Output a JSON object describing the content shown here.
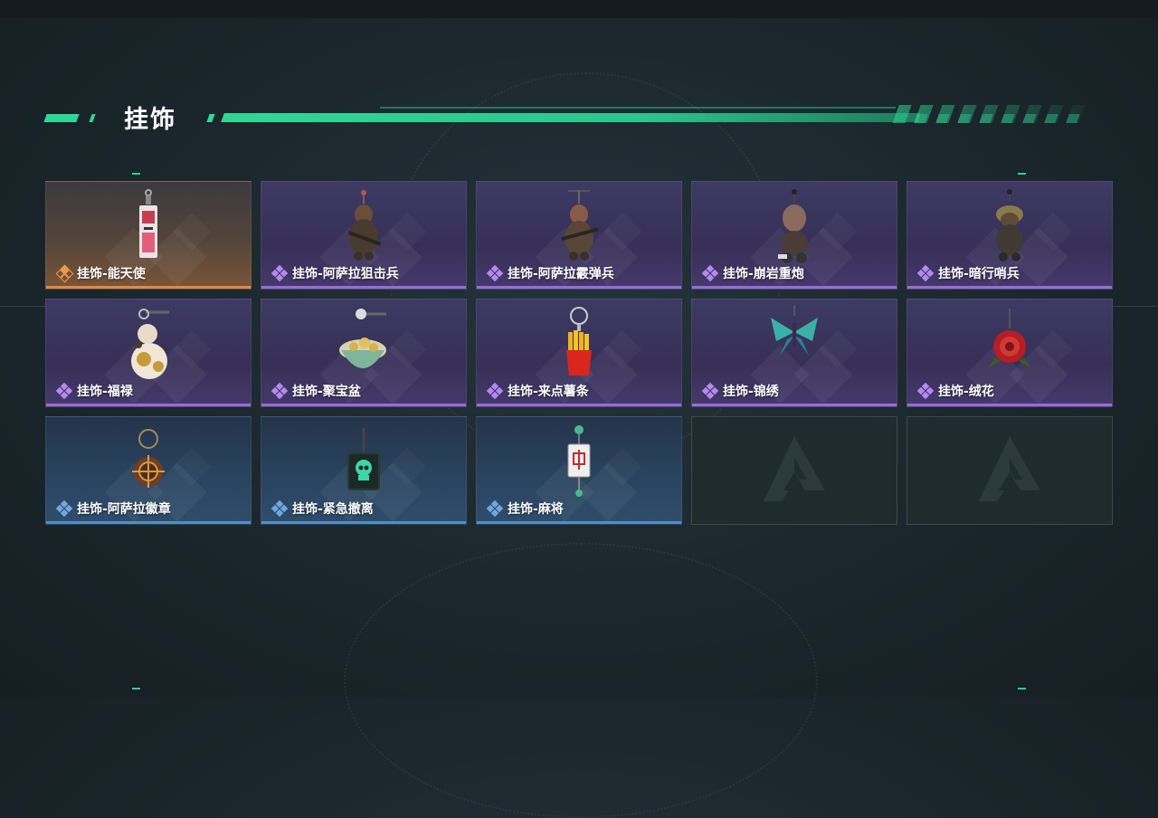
{
  "page": {
    "title": "挂饰"
  },
  "items": [
    {
      "label": "挂饰-能天使",
      "rarity": "orange",
      "icon": "angel-keychain-icon"
    },
    {
      "label": "挂饰-阿萨拉狙击兵",
      "rarity": "purple",
      "icon": "sniper-soldier-charm-icon"
    },
    {
      "label": "挂饰-阿萨拉霰弹兵",
      "rarity": "purple",
      "icon": "shotgun-soldier-charm-icon"
    },
    {
      "label": "挂饰-崩岩重炮",
      "rarity": "purple",
      "icon": "heavy-gunner-charm-icon"
    },
    {
      "label": "挂饰-暗行哨兵",
      "rarity": "purple",
      "icon": "sentry-charm-icon"
    },
    {
      "label": "挂饰-福禄",
      "rarity": "purple",
      "icon": "gourd-charm-icon"
    },
    {
      "label": "挂饰-聚宝盆",
      "rarity": "purple",
      "icon": "treasure-bowl-charm-icon"
    },
    {
      "label": "挂饰-来点薯条",
      "rarity": "purple",
      "icon": "fries-charm-icon"
    },
    {
      "label": "挂饰-锦绣",
      "rarity": "purple",
      "icon": "butterfly-charm-icon"
    },
    {
      "label": "挂饰-绒花",
      "rarity": "purple",
      "icon": "rose-charm-icon"
    },
    {
      "label": "挂饰-阿萨拉徽章",
      "rarity": "blue",
      "icon": "badge-charm-icon"
    },
    {
      "label": "挂饰-紧急撤离",
      "rarity": "blue",
      "icon": "skull-tag-charm-icon"
    },
    {
      "label": "挂饰-麻将",
      "rarity": "blue",
      "icon": "mahjong-tile-charm-icon"
    }
  ],
  "empty_slots": 2,
  "colors": {
    "accent": "#2fd795",
    "purple": "#9a6bd9",
    "orange": "#e08a43",
    "blue": "#4f8fc9"
  }
}
